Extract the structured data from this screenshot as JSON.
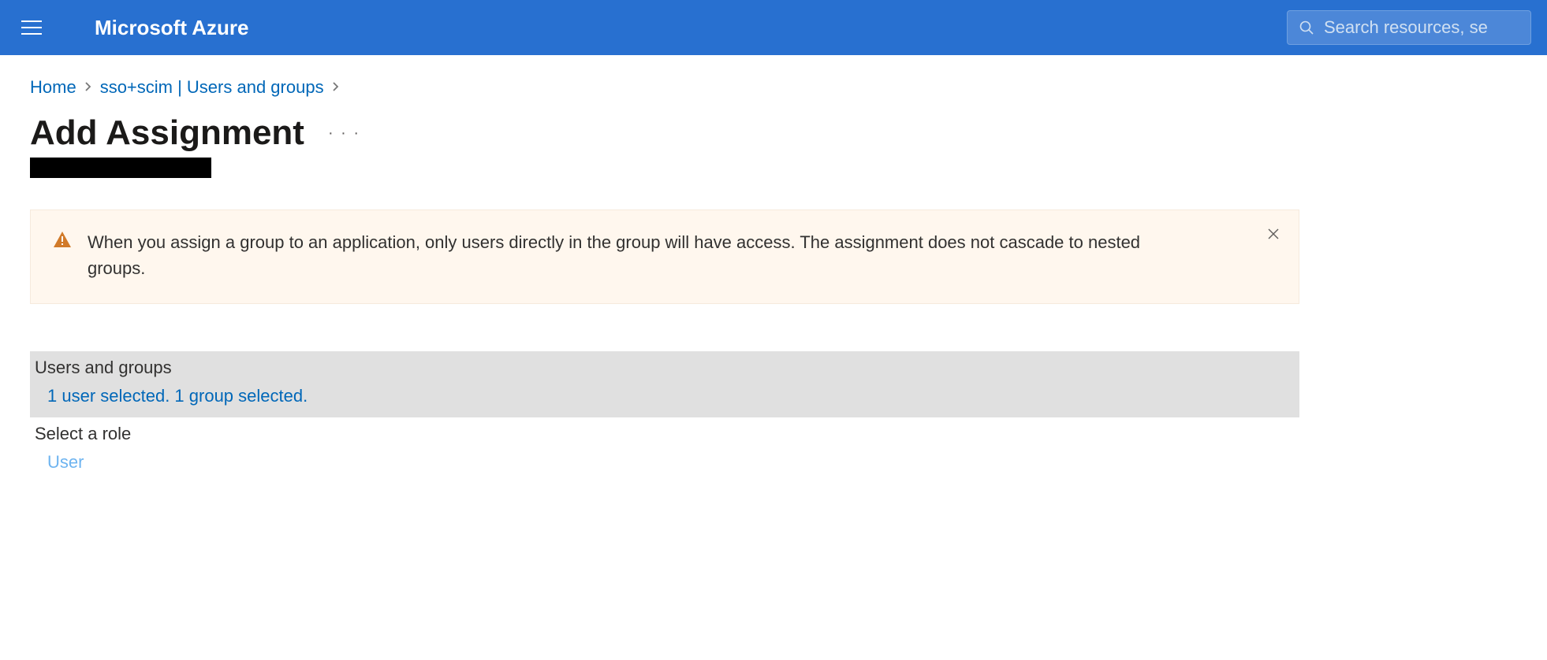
{
  "header": {
    "brand": "Microsoft Azure",
    "search_placeholder": "Search resources, se"
  },
  "breadcrumb": {
    "home": "Home",
    "app": "sso+scim | Users and groups"
  },
  "page": {
    "title": "Add Assignment"
  },
  "banner": {
    "text": "When you assign a group to an application, only users directly in the group will have access. The assignment does not cascade to nested groups."
  },
  "fields": {
    "users_groups_label": "Users and groups",
    "users_groups_value": "1 user selected. 1 group selected.",
    "role_label": "Select a role",
    "role_value": "User"
  }
}
